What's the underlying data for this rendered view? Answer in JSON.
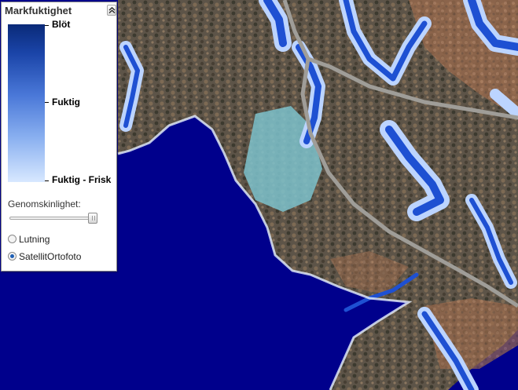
{
  "legend": {
    "title": "Markfuktighet",
    "collapse_icon": "chevron-up-icon",
    "scale_labels": [
      "Blöt",
      "Fuktig",
      "Fuktig - Frisk"
    ],
    "scale_colors": [
      "#0a2a78",
      "#1a44a8",
      "#4a78d8",
      "#8ab0f0",
      "#d8e8ff"
    ],
    "opacity_label": "Genomskinlighet:",
    "opacity_value": 1.0,
    "base_layers": [
      {
        "label": "Lutning",
        "checked": false
      },
      {
        "label": "SatellitOrtofoto",
        "checked": true
      }
    ]
  },
  "map": {
    "water_color": "#00008c",
    "moisture_color": "#1e50d2"
  }
}
